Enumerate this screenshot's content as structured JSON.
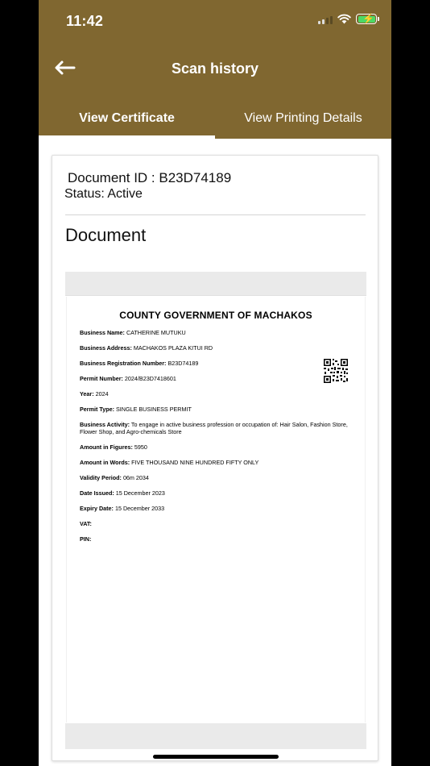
{
  "status_bar": {
    "time": "11:42",
    "icons": [
      "signal-icon",
      "wifi-icon",
      "battery-charging-icon"
    ]
  },
  "header": {
    "title": "Scan history",
    "back_icon": "arrow-left-icon"
  },
  "tabs": [
    {
      "label": "View Certificate",
      "active": true
    },
    {
      "label": "View Printing Details",
      "active": false
    }
  ],
  "document": {
    "id_label": "Document ID : B23D74189",
    "status_label": "Status: Active",
    "heading": "Document"
  },
  "certificate": {
    "title": "COUNTY GOVERNMENT OF MACHAKOS",
    "fields": [
      {
        "label": "Business Name:",
        "value": "CATHERINE MUTUKU"
      },
      {
        "label": "Business Address:",
        "value": "MACHAKOS PLAZA KITUI RD"
      },
      {
        "label": "Business Registration Number:",
        "value": "B23D74189"
      },
      {
        "label": "Permit Number:",
        "value": "2024/B23D7418601"
      },
      {
        "label": "Year:",
        "value": "2024"
      },
      {
        "label": "Permit Type:",
        "value": "SINGLE BUSINESS PERMIT"
      },
      {
        "label": "Business Activity:",
        "value": "To engage in active business profession or occupation of: Hair Salon, Fashion Store, Flower Shop, and Agro-chemicals Store"
      },
      {
        "label": "Amount in Figures:",
        "value": "5950"
      },
      {
        "label": "Amount in Words:",
        "value": "FIVE THOUSAND NINE HUNDRED FIFTY ONLY"
      },
      {
        "label": "Validity Period:",
        "value": "06m 2034"
      },
      {
        "label": "Date Issued:",
        "value": "15 December 2023"
      },
      {
        "label": "Expiry Date:",
        "value": "15 December 2033"
      },
      {
        "label": "VAT:",
        "value": ""
      },
      {
        "label": "PIN:",
        "value": ""
      }
    ]
  },
  "colors": {
    "header_bg": "#806730",
    "active_tab_indicator": "#ffffff"
  }
}
